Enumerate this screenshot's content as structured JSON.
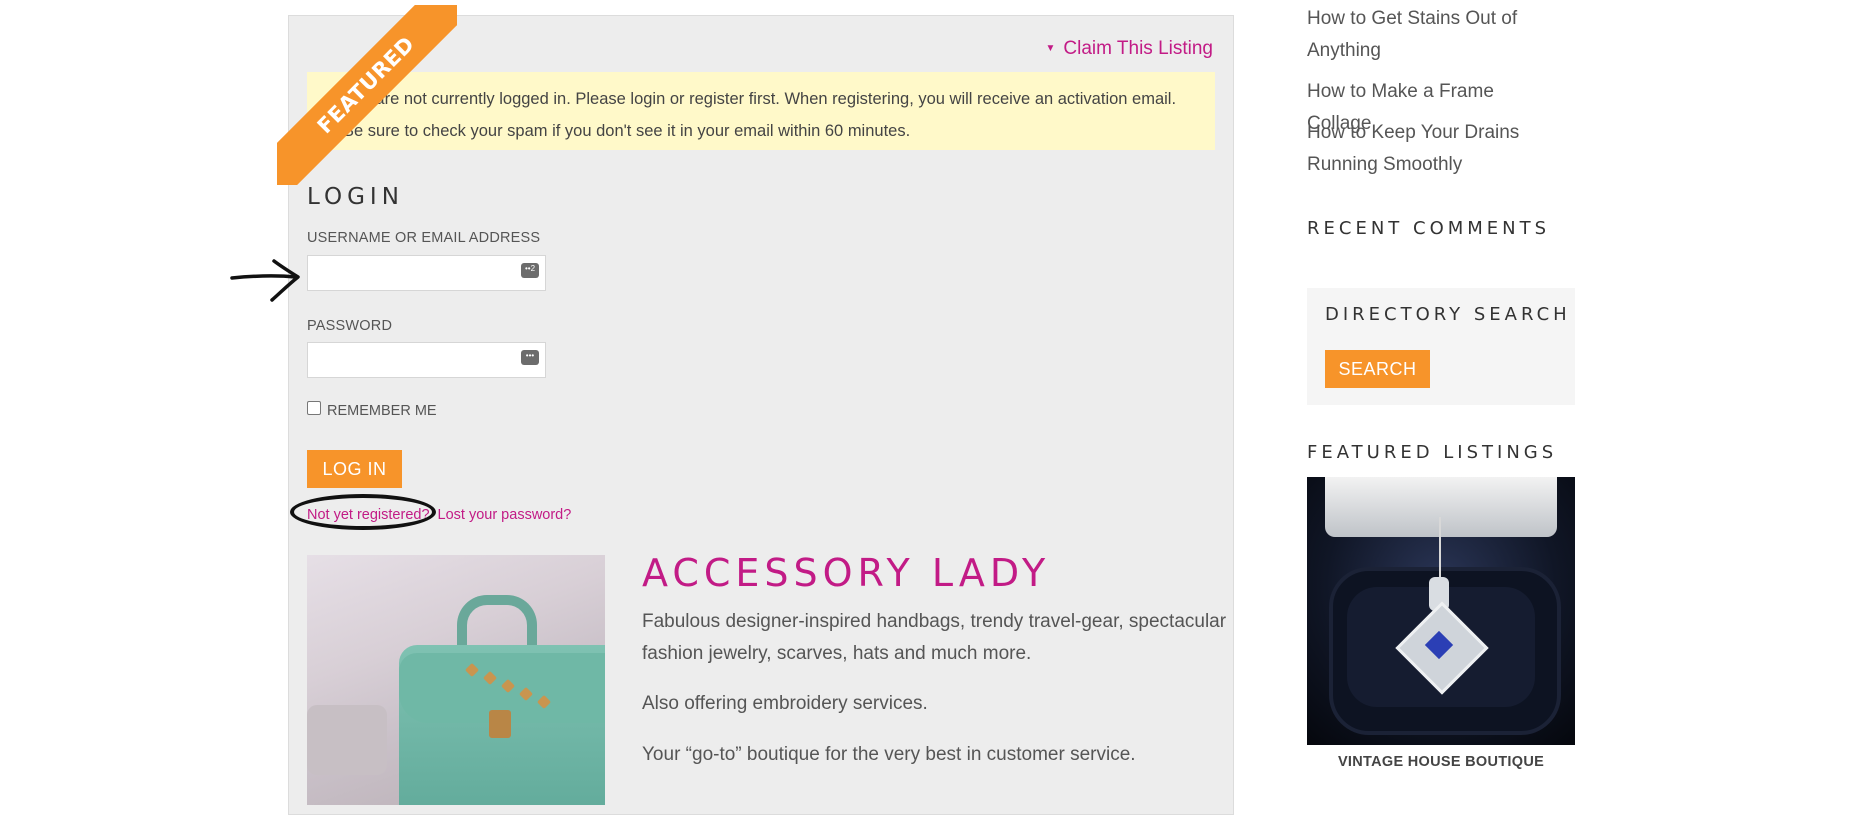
{
  "listing": {
    "ribbon_label": "FEATURED",
    "claim_label": "Claim This Listing",
    "notice": "You are not currently logged in. Please login or register first. When registering, you will receive an activation email. Be sure to check your spam if you don't see it in your email within 60 minutes."
  },
  "login": {
    "title": "LOGIN",
    "username_label": "USERNAME OR EMAIL ADDRESS",
    "username_value": "",
    "password_label": "PASSWORD",
    "password_value": "",
    "remember_label": "REMEMBER ME",
    "remember_checked": false,
    "submit_label": "LOG IN",
    "register_link": "Not yet registered?",
    "lost_password_link": "Lost your password?"
  },
  "business": {
    "name": "ACCESSORY LADY",
    "paragraphs": [
      "Fabulous designer-inspired handbags, trendy travel-gear, spectacular fashion jewelry, scarves, hats and much more.",
      "Also offering embroidery services.",
      "Your “go-to” boutique for the very best in customer service."
    ]
  },
  "sidebar": {
    "recent_posts": [
      "How to Get Stains Out of Anything",
      "How to Make a Frame Collage",
      "How to Keep Your Drains Running Smoothly"
    ],
    "recent_comments_title": "RECENT COMMENTS",
    "directory_search_title": "DIRECTORY SEARCH",
    "search_button": "SEARCH",
    "featured_listings_title": "FEATURED LISTINGS",
    "featured_listing_name": "VINTAGE HOUSE BOUTIQUE"
  },
  "colors": {
    "accent_orange": "#f7942a",
    "link_magenta": "#c21b86",
    "notice_yellow": "#fff9c9",
    "panel_gray": "#ededed"
  },
  "icons": {
    "claim": "triangle-down-icon",
    "username_field": "contact-card-icon",
    "password_field": "password-dots-icon",
    "annotation_arrow": "arrow-right-icon"
  }
}
